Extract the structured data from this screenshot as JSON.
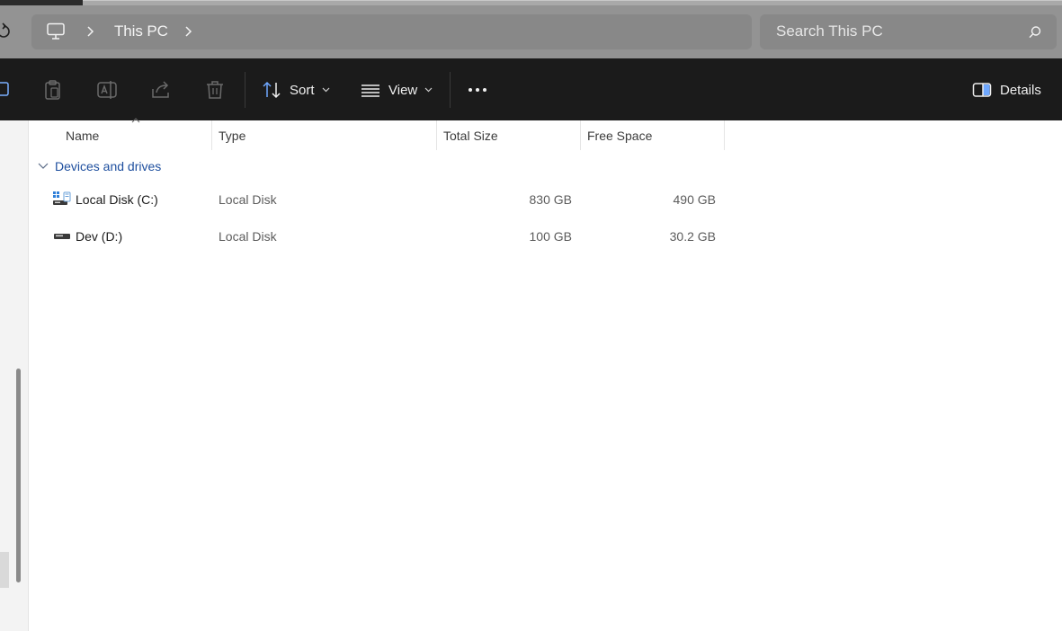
{
  "address_bar": {
    "location_label": "This PC",
    "search_placeholder": "Search This PC"
  },
  "command_bar": {
    "sort_label": "Sort",
    "view_label": "View",
    "details_label": "Details"
  },
  "columns": {
    "name": "Name",
    "type": "Type",
    "total_size": "Total Size",
    "free_space": "Free Space"
  },
  "group": {
    "label": "Devices and drives"
  },
  "drives": [
    {
      "name": "Local Disk (C:)",
      "type": "Local Disk",
      "total_size": "830 GB",
      "free_space": "490 GB",
      "icon": "windows-drive-icon"
    },
    {
      "name": "Dev (D:)",
      "type": "Local Disk",
      "total_size": "100 GB",
      "free_space": "30.2 GB",
      "icon": "drive-icon"
    }
  ],
  "colors": {
    "accent": "#1d4e9e",
    "command_bar_bg": "#1b1b1b",
    "address_bar_bg": "#939393"
  }
}
